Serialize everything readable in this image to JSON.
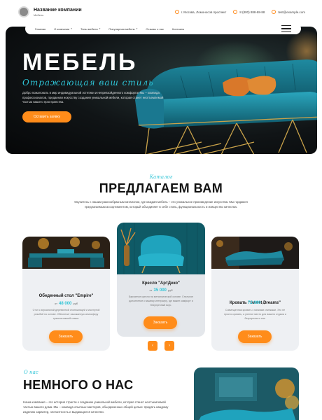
{
  "header": {
    "brand_name": "Название компании",
    "brand_sub": "Мебель",
    "address": "г. Москва, Ломоносов проспект",
    "phone": "8 (800) 888-88-88",
    "email": "test@example.com"
  },
  "nav": {
    "items": [
      {
        "label": "Главная",
        "dropdown": false
      },
      {
        "label": "О компании",
        "dropdown": true
      },
      {
        "label": "Типы мебели",
        "dropdown": true
      },
      {
        "label": "Популярная мебель",
        "dropdown": true
      },
      {
        "label": "Отзывы о нас",
        "dropdown": false
      },
      {
        "label": "Контакты",
        "dropdown": false
      }
    ]
  },
  "hero": {
    "title": "МЕБЕЛЬ",
    "script": "Отражающая ваш стиль",
    "text": "Добро пожаловать в мир индивидуальной эстетики и непревзойденного комфорта! Мы – команда профессионалов, преданная искусству создания уникальной мебели, которая станет неотъемлемой частью вашего пространства.",
    "button": "Оставить заявку"
  },
  "catalog": {
    "script": "Каталог",
    "title": "ПРЕДЛАГАЕМ ВАМ",
    "description": "Окунитесь с нашим разнообразным каталогом, где каждая мебель – это уникальное произведение искусства. Мы гордимся предлагаемым ассортиментом, который объединяет в себе стиль, функциональность и изящество качества.",
    "cards": [
      {
        "title": "Обеденный стол \"Empire\"",
        "price_prefix": "от",
        "price": "48 000",
        "currency": "руб",
        "description": "Стол с зеркальной деревянной столешницей и изогнутой резьбой по основе. Обеспечит изысканную атмосферу трапезы вашей семьи.",
        "button": "Заказать"
      },
      {
        "title": "Кресло \"АртДеко\"",
        "price_prefix": "от",
        "price": "35 000",
        "currency": "руб",
        "description": "Бархатное кресло на металлической основе. Стильное дополнение к вашему интерьеру, где важен комфорт и безупречный вкус.",
        "button": "Заказать"
      },
      {
        "title": "Кровать \"Sweet Dreams\"",
        "price_prefix": "от",
        "price": "72 000",
        "currency": "руб",
        "description": "Совмещенная кровать с мягкими спинками. Это не просто кровать, а уютное место для вашего отдыха и безупречного сна.",
        "button": "Заказать"
      }
    ],
    "prev_label": "‹",
    "next_label": "›"
  },
  "about": {
    "script": "О нас",
    "title": "НЕМНОГО О НАС",
    "text": "Наша компания – это история страсти к созданию уникальной мебели, которая станет неотъемлемой частью вашего дома. Мы – команда опытных мастеров, объединенных общей целью: придать каждому изделию характер, элегантность и выдающееся качество."
  },
  "colors": {
    "accent": "#ff8c1a",
    "script": "#2ec4d6",
    "card_bg": "#eef0f3"
  }
}
